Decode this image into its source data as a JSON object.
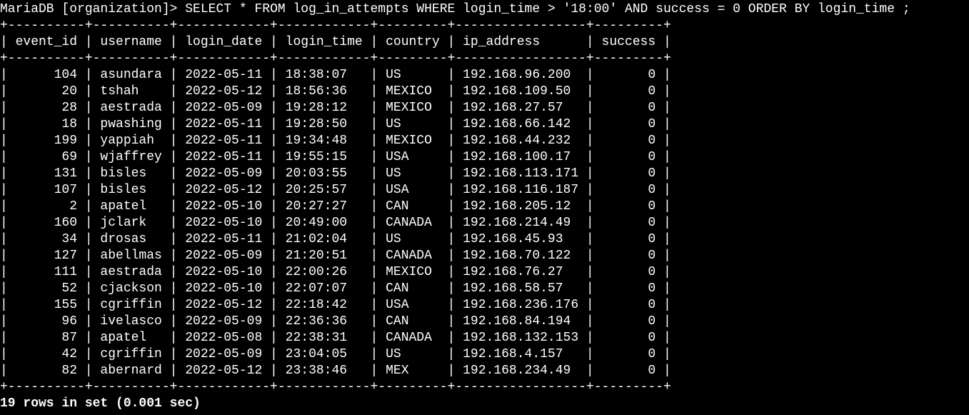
{
  "terminal": {
    "prompt": "MariaDB [organization]> ",
    "command": "SELECT * FROM log_in_attempts WHERE login_time > '18:00' AND success = 0 ORDER BY login_time ;",
    "columns": [
      "event_id",
      "username",
      "login_date",
      "login_time",
      "country",
      "ip_address",
      "success"
    ],
    "rows": [
      [
        "104",
        "asundara",
        "2022-05-11",
        "18:38:07",
        "US",
        "192.168.96.200",
        "0"
      ],
      [
        "20",
        "tshah",
        "2022-05-12",
        "18:56:36",
        "MEXICO",
        "192.168.109.50",
        "0"
      ],
      [
        "28",
        "aestrada",
        "2022-05-09",
        "19:28:12",
        "MEXICO",
        "192.168.27.57",
        "0"
      ],
      [
        "18",
        "pwashing",
        "2022-05-11",
        "19:28:50",
        "US",
        "192.168.66.142",
        "0"
      ],
      [
        "199",
        "yappiah",
        "2022-05-11",
        "19:34:48",
        "MEXICO",
        "192.168.44.232",
        "0"
      ],
      [
        "69",
        "wjaffrey",
        "2022-05-11",
        "19:55:15",
        "USA",
        "192.168.100.17",
        "0"
      ],
      [
        "131",
        "bisles",
        "2022-05-09",
        "20:03:55",
        "US",
        "192.168.113.171",
        "0"
      ],
      [
        "107",
        "bisles",
        "2022-05-12",
        "20:25:57",
        "USA",
        "192.168.116.187",
        "0"
      ],
      [
        "2",
        "apatel",
        "2022-05-10",
        "20:27:27",
        "CAN",
        "192.168.205.12",
        "0"
      ],
      [
        "160",
        "jclark",
        "2022-05-10",
        "20:49:00",
        "CANADA",
        "192.168.214.49",
        "0"
      ],
      [
        "34",
        "drosas",
        "2022-05-11",
        "21:02:04",
        "US",
        "192.168.45.93",
        "0"
      ],
      [
        "127",
        "abellmas",
        "2022-05-09",
        "21:20:51",
        "CANADA",
        "192.168.70.122",
        "0"
      ],
      [
        "111",
        "aestrada",
        "2022-05-10",
        "22:00:26",
        "MEXICO",
        "192.168.76.27",
        "0"
      ],
      [
        "52",
        "cjackson",
        "2022-05-10",
        "22:07:07",
        "CAN",
        "192.168.58.57",
        "0"
      ],
      [
        "155",
        "cgriffin",
        "2022-05-12",
        "22:18:42",
        "USA",
        "192.168.236.176",
        "0"
      ],
      [
        "96",
        "ivelasco",
        "2022-05-09",
        "22:36:36",
        "CAN",
        "192.168.84.194",
        "0"
      ],
      [
        "87",
        "apatel",
        "2022-05-08",
        "22:38:31",
        "CANADA",
        "192.168.132.153",
        "0"
      ],
      [
        "42",
        "cgriffin",
        "2022-05-09",
        "23:04:05",
        "US",
        "192.168.4.157",
        "0"
      ],
      [
        "82",
        "abernard",
        "2022-05-12",
        "23:38:46",
        "MEX",
        "192.168.234.49",
        "0"
      ]
    ],
    "summary": "19 rows in set (0.001 sec)"
  },
  "colors": {
    "background": "#000000",
    "text": "#ffffff"
  }
}
